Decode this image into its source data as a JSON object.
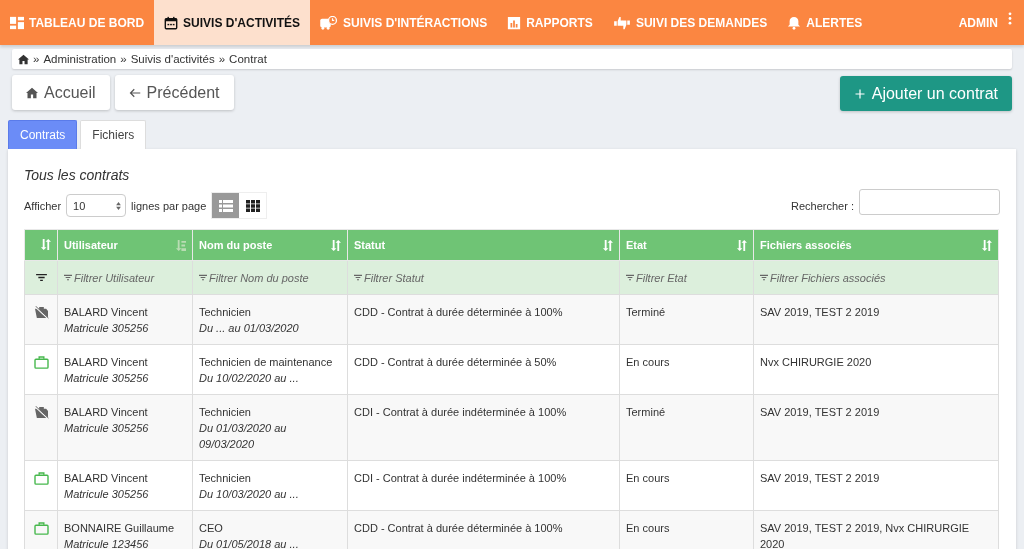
{
  "nav": {
    "items": [
      {
        "label": "TABLEAU DE BORD",
        "selected": false
      },
      {
        "label": "SUIVIS D'ACTIVITÉS",
        "selected": true
      },
      {
        "label": "SUIVIS D'INTÉRACTIONS",
        "selected": false
      },
      {
        "label": "RAPPORTS",
        "selected": false
      },
      {
        "label": "SUIVI DES DEMANDES",
        "selected": false
      },
      {
        "label": "ALERTES",
        "selected": false
      }
    ],
    "user": "ADMIN"
  },
  "breadcrumb": {
    "separator": "»",
    "items": [
      "Administration",
      "Suivis d'activités",
      "Contrat"
    ]
  },
  "buttons": {
    "home": "Accueil",
    "back": "Précédent",
    "add": "Ajouter un contrat"
  },
  "tabs": [
    {
      "label": "Contrats",
      "selected": true
    },
    {
      "label": "Fichiers",
      "selected": false
    }
  ],
  "panel": {
    "title": "Tous les contrats",
    "show_label": "Afficher",
    "page_size": "10",
    "per_page_label": "lignes par page",
    "view_modes": [
      {
        "selected": true
      },
      {
        "selected": false
      }
    ],
    "search_label": "Rechercher :"
  },
  "table": {
    "columns": [
      {
        "label": "Utilisateur",
        "sorted": true,
        "filter": "Filtrer Utilisateur"
      },
      {
        "label": "Nom du poste",
        "sorted": false,
        "filter": "Filtrer Nom du poste"
      },
      {
        "label": "Statut",
        "sorted": false,
        "filter": "Filtrer Statut"
      },
      {
        "label": "Etat",
        "sorted": false,
        "filter": "Filtrer Etat"
      },
      {
        "label": "Fichiers associés",
        "sorted": false,
        "filter": "Filtrer Fichiers associés"
      }
    ],
    "rows": [
      {
        "active": false,
        "user": "BALARD Vincent",
        "matricule": "Matricule 305256",
        "poste": "Technicien",
        "period": "Du ... au 01/03/2020",
        "statut": "CDD - Contrat à durée déterminée à 100%",
        "etat": "Terminé",
        "fichiers": "SAV 2019, TEST 2 2019"
      },
      {
        "active": true,
        "user": "BALARD Vincent",
        "matricule": "Matricule 305256",
        "poste": "Technicien de maintenance",
        "period": "Du 10/02/2020 au ...",
        "statut": "CDD - Contrat à durée déterminée à 50%",
        "etat": "En cours",
        "fichiers": "Nvx CHIRURGIE 2020"
      },
      {
        "active": false,
        "user": "BALARD Vincent",
        "matricule": "Matricule 305256",
        "poste": "Technicien",
        "period": "Du 01/03/2020 au 09/03/2020",
        "statut": "CDI - Contrat à durée indéterminée à 100%",
        "etat": "Terminé",
        "fichiers": "SAV 2019, TEST 2 2019"
      },
      {
        "active": true,
        "user": "BALARD Vincent",
        "matricule": "Matricule 305256",
        "poste": "Technicien",
        "period": "Du 10/03/2020 au ...",
        "statut": "CDI - Contrat à durée indéterminée à 100%",
        "etat": "En cours",
        "fichiers": "SAV 2019, TEST 2 2019"
      },
      {
        "active": true,
        "user": "BONNAIRE Guillaume",
        "matricule": "Matricule 123456",
        "poste": "CEO",
        "period": "Du 01/05/2018 au ...",
        "statut": "CDD - Contrat à durée déterminée à 100%",
        "etat": "En cours",
        "fichiers": "SAV 2019, TEST 2 2019, Nvx CHIRURGIE 2020"
      }
    ]
  }
}
